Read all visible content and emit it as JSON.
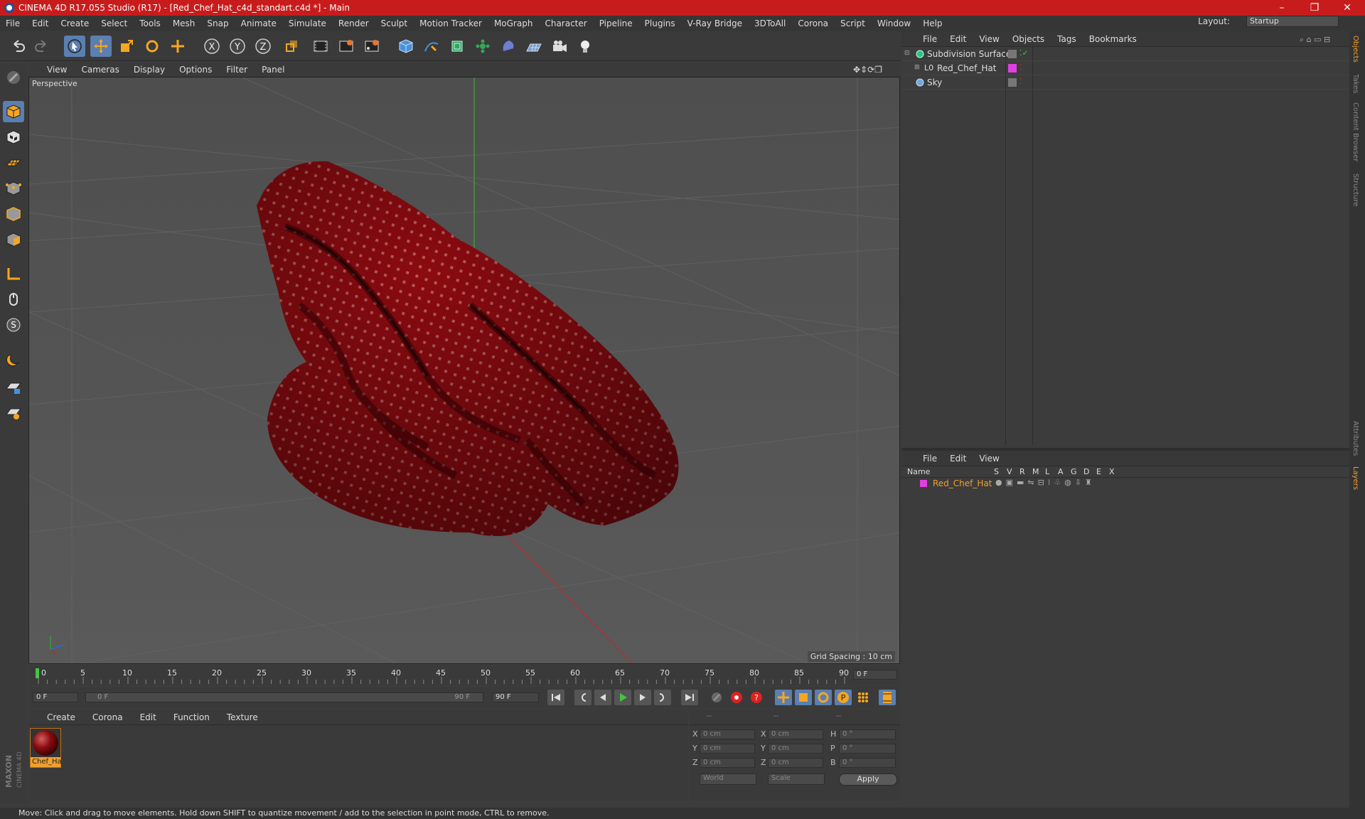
{
  "window": {
    "title": "CINEMA 4D R17.055 Studio (R17) - [Red_Chef_Hat_c4d_standart.c4d *] - Main",
    "minimize": "–",
    "restore": "❐",
    "close": "✕"
  },
  "menu": [
    "File",
    "Edit",
    "Create",
    "Select",
    "Tools",
    "Mesh",
    "Snap",
    "Animate",
    "Simulate",
    "Render",
    "Sculpt",
    "Motion Tracker",
    "MoGraph",
    "Character",
    "Pipeline",
    "Plugins",
    "V-Ray Bridge",
    "3DToAll",
    "Corona",
    "Script",
    "Window",
    "Help"
  ],
  "layout": {
    "label": "Layout:",
    "value": "Startup"
  },
  "viewport": {
    "menu": [
      "View",
      "Cameras",
      "Display",
      "Options",
      "Filter",
      "Panel"
    ],
    "label": "Perspective",
    "grid_spacing": "Grid Spacing : 10 cm"
  },
  "timeline": {
    "ticks": [
      "0",
      "5",
      "10",
      "15",
      "20",
      "25",
      "30",
      "35",
      "40",
      "45",
      "50",
      "55",
      "60",
      "65",
      "70",
      "75",
      "80",
      "85",
      "90"
    ],
    "current_frame": "0 F"
  },
  "transport": {
    "start": "0 F",
    "range_start": "0 F",
    "range_end": "90 F",
    "end": "90 F"
  },
  "materials": {
    "menu": [
      "Create",
      "Corona",
      "Edit",
      "Function",
      "Texture"
    ],
    "items": [
      {
        "name": "Chef_Ha"
      }
    ]
  },
  "coords": {
    "headers": [
      "--",
      "--",
      "--"
    ],
    "rows": [
      {
        "a": "X",
        "av": "0 cm",
        "b": "X",
        "bv": "0 cm",
        "c": "H",
        "cv": "0 °"
      },
      {
        "a": "Y",
        "av": "0 cm",
        "b": "Y",
        "bv": "0 cm",
        "c": "P",
        "cv": "0 °"
      },
      {
        "a": "Z",
        "av": "0 cm",
        "b": "Z",
        "bv": "0 cm",
        "c": "B",
        "cv": "0 °"
      }
    ],
    "world": "World",
    "scale": "Scale",
    "apply": "Apply"
  },
  "objects": {
    "menu": [
      "File",
      "Edit",
      "View",
      "Objects",
      "Tags",
      "Bookmarks"
    ],
    "items": [
      {
        "name": "Subdivision Surface",
        "color": "#2ec27e"
      },
      {
        "name": "Red_Chef_Hat",
        "color": "#e040e0"
      },
      {
        "name": "Sky",
        "color": "#6fa8dc"
      }
    ]
  },
  "layers": {
    "menu": [
      "File",
      "Edit",
      "View"
    ],
    "columns": [
      "Name",
      "S",
      "V",
      "R",
      "M",
      "L",
      "A",
      "G",
      "D",
      "E",
      "X"
    ],
    "items": [
      {
        "name": "Red_Chef_Hat",
        "color": "#e040e0"
      }
    ]
  },
  "side_tabs": [
    "Objects",
    "Takes",
    "Content Browser",
    "Structure",
    "Attributes",
    "Layers"
  ],
  "brand": "MAXON CINEMA 4D",
  "status": "Move: Click and drag to move elements. Hold down SHIFT to quantize movement / add to the selection in point mode, CTRL to remove.",
  "colors": {
    "title_bar": "#c81c1c",
    "accent": "#5a7fb0",
    "hat": "#8b0b10",
    "selected_text": "#f0a030"
  }
}
